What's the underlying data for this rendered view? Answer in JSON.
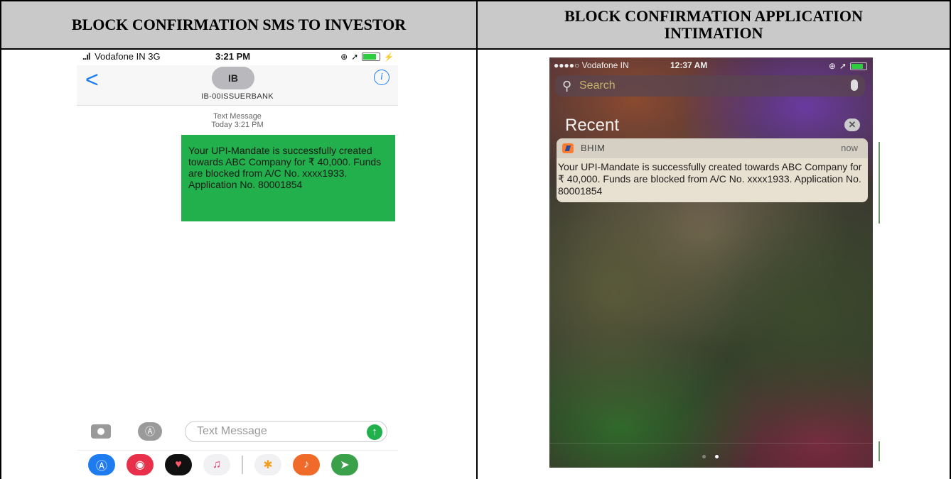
{
  "table": {
    "left_header": "BLOCK CONFIRMATION SMS TO INVESTOR",
    "right_header_line1": "BLOCK CONFIRMATION APPLICATION",
    "right_header_line2": "INTIMATION"
  },
  "sms_screen": {
    "status": {
      "signal": "..ıl",
      "carrier": "Vodafone IN",
      "network": "3G",
      "time": "3:21 PM"
    },
    "nav": {
      "back": "<",
      "avatar_initials": "IB",
      "contact": "IB-00ISSUERBANK",
      "info": "i"
    },
    "meta_line1": "Text Message",
    "meta_line2": "Today 3:21 PM",
    "message": "Your UPI-Mandate is successfully created towards ABC Company for ₹ 40,000. Funds are blocked from A/C No. xxxx1933. Application No. 80001854",
    "compose_placeholder": "Text Message",
    "colors": {
      "bubble": "#21b04b",
      "link": "#1a7cf5"
    }
  },
  "lock_screen": {
    "status": {
      "carrier": "●●●●○ Vodafone IN",
      "time": "12:37 AM"
    },
    "search_placeholder": "Search",
    "section_title": "Recent",
    "notification": {
      "app": "BHIM",
      "time": "now",
      "body": "Your UPI-Mandate is successfully created towards ABC Company for ₹ 40,000. Funds are blocked from A/C No. xxxx1933. Application No. 80001854"
    }
  }
}
